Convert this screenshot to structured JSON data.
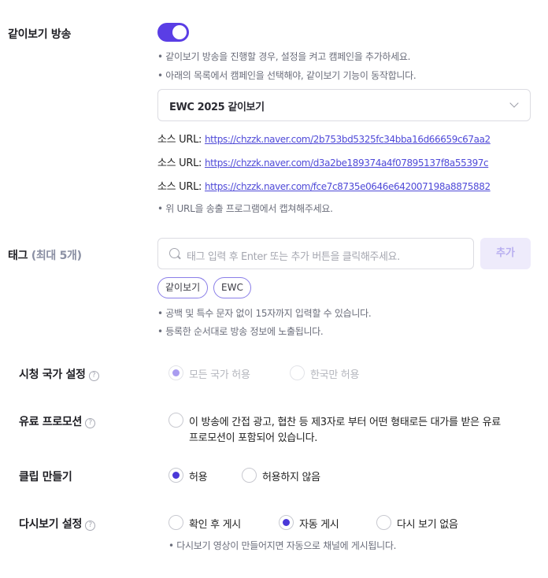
{
  "replay_broadcast": {
    "label": "같이보기 방송",
    "toggle_on": true,
    "notes": [
      "• 같이보기 방송을 진행할 경우, 설정을 켜고 캠페인을 추가하세요.",
      "• 아래의 목록에서 캠페인을 선택해야, 같이보기 기능이 동작합니다."
    ],
    "campaign_select": "EWC 2025 같이보기",
    "source_label": "소스 URL: ",
    "source_urls": [
      "https://chzzk.naver.com/2b753bd5325fc34bba16d66659c67aa2",
      "https://chzzk.naver.com/d3a2be189374a4f07895137f8a55397c",
      "https://chzzk.naver.com/fce7c8735e0646e642007198a8875882"
    ],
    "url_note": "• 위 URL을 송출 프로그램에서 캡쳐해주세요."
  },
  "tags": {
    "label": "태그",
    "label_sub": "(최대 5개)",
    "placeholder": "태그 입력 후 Enter 또는 추가 버튼을 클릭해주세요.",
    "add_button": "추가",
    "chips": [
      "같이보기",
      "EWC"
    ],
    "notes": [
      "• 공백 및 특수 문자 없이 15자까지 입력할 수 있습니다.",
      "• 등록한 순서대로 방송 정보에 노출됩니다."
    ]
  },
  "viewing_country": {
    "label": "시청 국가 설정",
    "options": [
      "모든 국가 허용",
      "한국만 허용"
    ],
    "selected": 0,
    "disabled": true
  },
  "paid_promotion": {
    "label": "유료 프로모션",
    "text_line1": "이 방송에 간접 광고, 협찬 등 제3자로 부터 어떤 형태로든 대가를 받은 유료",
    "text_line2": "프로모션이 포함되어 있습니다.",
    "checked": false
  },
  "clip_creation": {
    "label": "클립 만들기",
    "options": [
      "허용",
      "허용하지 않음"
    ],
    "selected": 0
  },
  "replay_setting": {
    "label": "다시보기 설정",
    "options": [
      "확인 후 게시",
      "자동 게시",
      "다시 보기 없음"
    ],
    "selected": 1,
    "note": "• 다시보기 영상이 만들어지면 자동으로 채널에 게시됩니다."
  },
  "icons": {
    "help": "question-circle-icon",
    "search": "search-icon",
    "chevron": "chevron-down-icon"
  },
  "colors": {
    "accent": "#5a3ee5",
    "link": "#4f4ad8"
  }
}
